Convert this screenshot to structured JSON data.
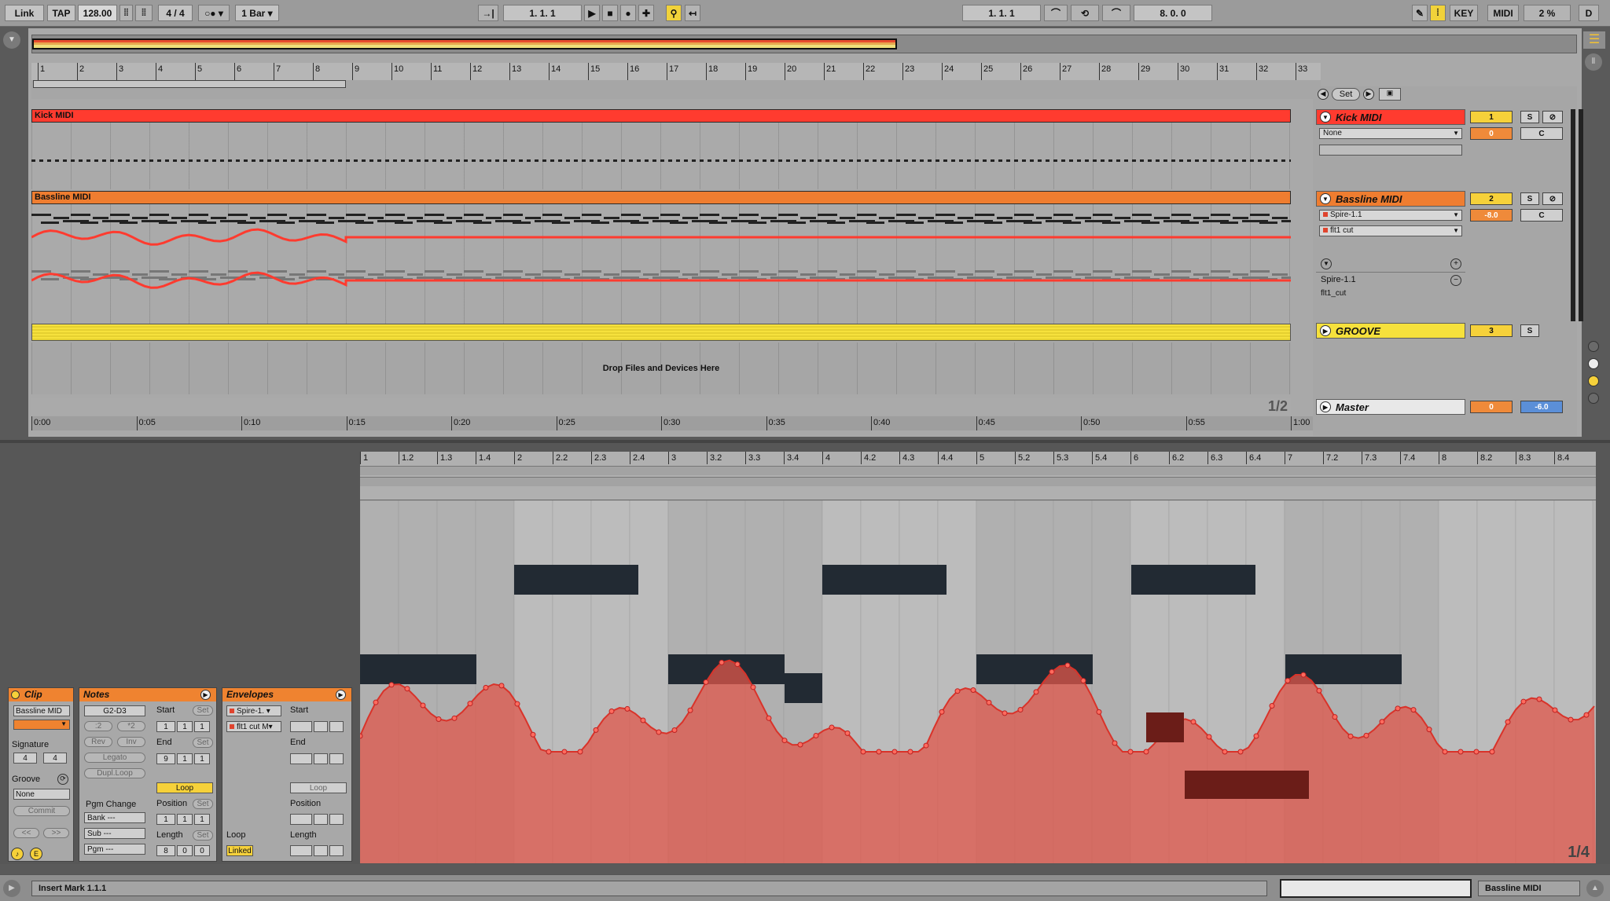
{
  "transport": {
    "link": "Link",
    "tap": "TAP",
    "tempo": "128.00",
    "signature": "4 / 4",
    "quantize": "1 Bar",
    "position": "1.   1.   1",
    "loop_start": "1.   1.   1",
    "loop_length": "8.   0.   0",
    "key": "KEY",
    "midi": "MIDI",
    "cpu": "2 %",
    "d": "D"
  },
  "arrangement": {
    "bars": [
      "1",
      "2",
      "3",
      "4",
      "5",
      "6",
      "7",
      "8",
      "9",
      "10",
      "11",
      "12",
      "13",
      "14",
      "15",
      "16",
      "17",
      "18",
      "19",
      "20",
      "21",
      "22",
      "23",
      "24",
      "25",
      "26",
      "27",
      "28",
      "29",
      "30",
      "31",
      "32",
      "33"
    ],
    "times": [
      "0:00",
      "0:05",
      "0:10",
      "0:15",
      "0:20",
      "0:25",
      "0:30",
      "0:35",
      "0:40",
      "0:45",
      "0:50",
      "0:55",
      "1:00"
    ],
    "set_label": "Set",
    "drop_text": "Drop Files and Devices Here",
    "page": "1/2",
    "tracks": [
      {
        "clip": "Kick MIDI",
        "name": "Kick MIDI",
        "color": "#ff3b2f",
        "input": "None",
        "number": "1",
        "volume": "0",
        "pan": "C",
        "solo": "S"
      },
      {
        "clip": "Bassline MIDI",
        "name": "Bassline MIDI",
        "color": "#ef7d30",
        "input": "Spire-1.1",
        "input2": "flt1 cut",
        "number": "2",
        "volume": "-8.0",
        "pan": "C",
        "solo": "S",
        "device": "Spire-1.1",
        "param": "flt1_cut"
      },
      {
        "name": "GROOVE",
        "color": "#f6e13c",
        "number": "3",
        "solo": "S"
      }
    ],
    "master": {
      "name": "Master",
      "volume": "0",
      "pan": "-6.0"
    }
  },
  "clip_panel": {
    "title": "Clip",
    "name": "Bassline MID",
    "signature_label": "Signature",
    "sig_num": "4",
    "sig_den": "4",
    "groove_label": "Groove",
    "groove_value": "None",
    "commit": "Commit",
    "prev": "<<",
    "next": ">>"
  },
  "notes_panel": {
    "title": "Notes",
    "range": "G2-D3",
    "half": ":2",
    "double": "*2",
    "rev": "Rev",
    "inv": "Inv",
    "legato": "Legato",
    "dupl": "Dupl.Loop",
    "start": "Start",
    "end": "End",
    "set": "Set",
    "loop": "Loop",
    "position": "Position",
    "length": "Length",
    "pgm_change": "Pgm Change",
    "bank": "Bank ---",
    "sub": "Sub ---",
    "pgm": "Pgm ---",
    "start_v": [
      "1",
      "1",
      "1"
    ],
    "end_v": [
      "9",
      "1",
      "1"
    ],
    "pos_v": [
      "1",
      "1",
      "1"
    ],
    "len_v": [
      "8",
      "0",
      "0"
    ]
  },
  "envelopes_panel": {
    "title": "Envelopes",
    "device": "Spire-1.",
    "param": "flt1 cut M",
    "start": "Start",
    "end": "End",
    "loop": "Loop",
    "position": "Position",
    "length": "Length",
    "loop_label": "Loop",
    "linked": "Linked"
  },
  "editor": {
    "ticks": [
      "1",
      "1.2",
      "1.3",
      "1.4",
      "2",
      "2.2",
      "2.3",
      "2.4",
      "3",
      "3.2",
      "3.3",
      "3.4",
      "4",
      "4.2",
      "4.3",
      "4.4",
      "5",
      "5.2",
      "5.3",
      "5.4",
      "6",
      "6.2",
      "6.3",
      "6.4",
      "7",
      "7.2",
      "7.3",
      "7.4",
      "8",
      "8.2",
      "8.3",
      "8.4"
    ],
    "page": "1/4",
    "envelope_color": "#e0574b"
  },
  "status": {
    "message": "Insert Mark 1.1.1",
    "track": "Bassline MIDI"
  }
}
